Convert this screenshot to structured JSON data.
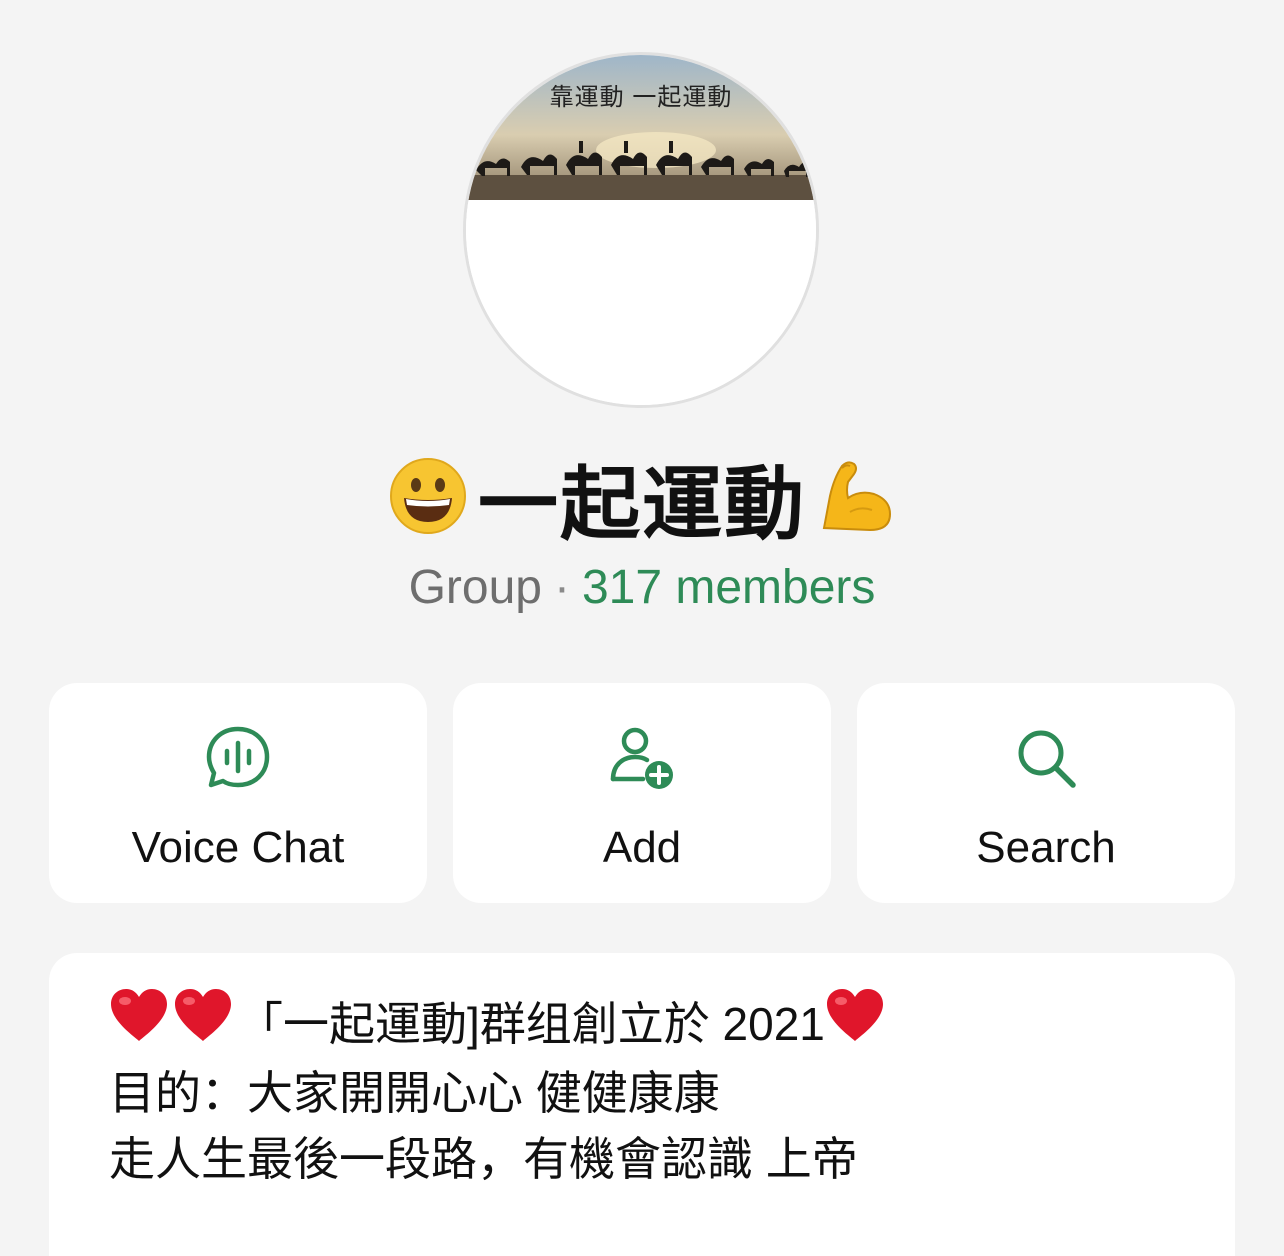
{
  "avatar": {
    "caption": "靠運動  一起運動"
  },
  "group": {
    "title": "一起運動",
    "leading_emoji_icon": "grinning-face-icon",
    "trailing_emoji_icon": "flexed-biceps-icon",
    "kind": "Group",
    "separator": "·",
    "members": "317 members"
  },
  "actions": [
    {
      "label": "Voice Chat",
      "icon": "voice-chat-icon"
    },
    {
      "label": "Add",
      "icon": "add-person-icon"
    },
    {
      "label": "Search",
      "icon": "search-icon"
    }
  ],
  "description": {
    "line1_text": "「一起運動]群组創立於 2021",
    "line2": "目的：大家開開心心 健健康康",
    "line3": "走人生最後一段路，有機會認識 上帝"
  },
  "colors": {
    "accent": "#2e8b57",
    "background": "#f4f4f4",
    "card": "#ffffff",
    "heart": "#e0162b"
  }
}
